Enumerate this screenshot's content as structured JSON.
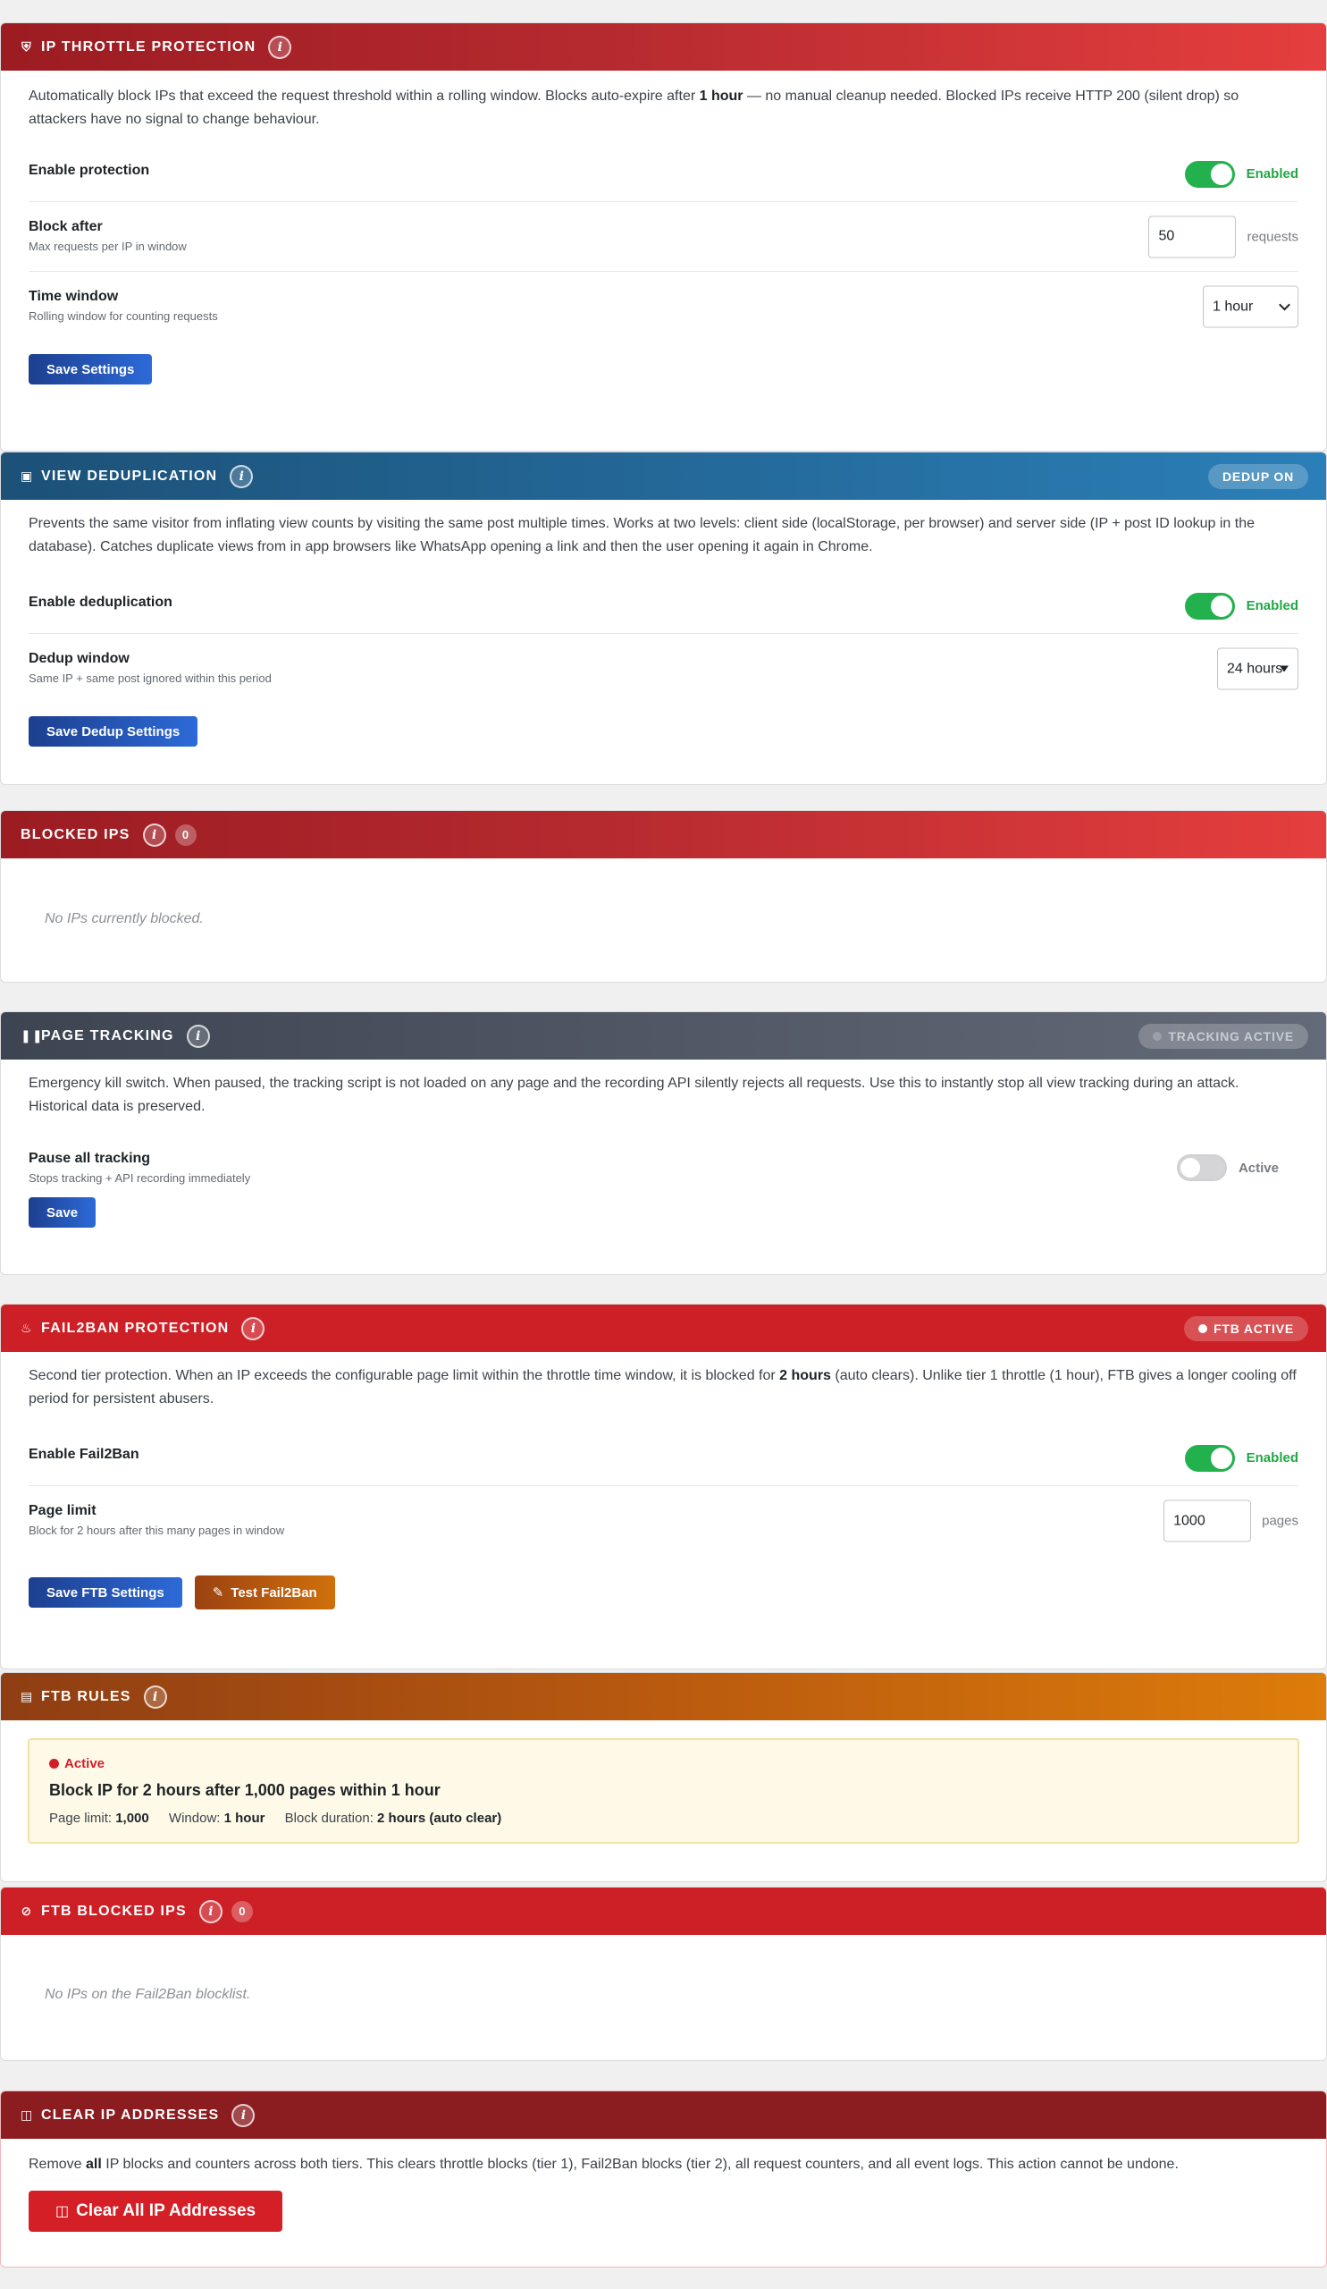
{
  "throttle": {
    "title": "IP THROTTLE PROTECTION",
    "desc_pre": "Automatically block IPs that exceed the request threshold within a rolling window. Blocks auto-expire after ",
    "desc_bold": "1 hour",
    "desc_post": " — no manual cleanup needed. Blocked IPs receive HTTP 200 (silent drop) so attackers have no signal to change behaviour.",
    "enable_label": "Enable protection",
    "enable_state": "Enabled",
    "block_label": "Block after",
    "block_sub": "Max requests per IP in window",
    "block_value": "50",
    "block_unit": "requests",
    "window_label": "Time window",
    "window_sub": "Rolling window for counting requests",
    "window_value": "1 hour",
    "save": "Save Settings"
  },
  "dedup": {
    "title": "VIEW DEDUPLICATION",
    "badge": "DEDUP ON",
    "desc": "Prevents the same visitor from inflating view counts by visiting the same post multiple times. Works at two levels: client side (localStorage, per browser) and server side (IP + post ID lookup in the database). Catches duplicate views from in app browsers like WhatsApp opening a link and then the user opening it again in Chrome.",
    "enable_label": "Enable deduplication",
    "enable_state": "Enabled",
    "window_label": "Dedup window",
    "window_sub": "Same IP + same post ignored within this period",
    "window_value": "24 hours",
    "save": "Save Dedup Settings"
  },
  "blocked": {
    "title": "BLOCKED IPS",
    "count": "0",
    "empty": "No IPs currently blocked."
  },
  "tracking": {
    "title": "PAGE TRACKING",
    "badge": "TRACKING ACTIVE",
    "desc": "Emergency kill switch. When paused, the tracking script is not loaded on any page and the recording API silently rejects all requests. Use this to instantly stop all view tracking during an attack. Historical data is preserved.",
    "pause_label": "Pause all tracking",
    "pause_sub": "Stops tracking + API recording immediately",
    "pause_state": "Active",
    "save": "Save"
  },
  "fail2ban": {
    "title": "FAIL2BAN PROTECTION",
    "badge": "FTB ACTIVE",
    "desc_pre": "Second tier protection. When an IP exceeds the configurable page limit within the throttle time window, it is blocked for ",
    "desc_bold": "2 hours",
    "desc_post": " (auto clears). Unlike tier 1 throttle (1 hour), FTB gives a longer cooling off period for persistent abusers.",
    "enable_label": "Enable Fail2Ban",
    "enable_state": "Enabled",
    "limit_label": "Page limit",
    "limit_sub": "Block for 2 hours after this many pages in window",
    "limit_value": "1000",
    "limit_unit": "pages",
    "save": "Save FTB Settings",
    "test": "Test Fail2Ban"
  },
  "rules": {
    "title": "FTB RULES",
    "status": "Active",
    "rule_title": "Block IP for 2 hours after 1,000 pages within 1 hour",
    "limit_k": "Page limit:",
    "limit_v": "1,000",
    "window_k": "Window:",
    "window_v": "1 hour",
    "duration_k": "Block duration:",
    "duration_v": "2 hours (auto clear)"
  },
  "ftb_blocked": {
    "title": "FTB BLOCKED IPS",
    "count": "0",
    "empty": "No IPs on the Fail2Ban blocklist."
  },
  "clear": {
    "title": "CLEAR IP ADDRESSES",
    "desc_pre": "Remove ",
    "desc_bold": "all",
    "desc_post": " IP blocks and counters across both tiers. This clears throttle blocks (tier 1), Fail2Ban blocks (tier 2), all request counters, and all event logs. This action cannot be undone.",
    "button": "Clear All IP Addresses"
  },
  "colors": {
    "red_gradient_start": "#9b1c22",
    "red_gradient_end": "#e53e3e",
    "blue_header": "#2b7fb8",
    "slate_header": "#4b5260",
    "crimson_header": "#cd2026",
    "orange_header": "#dd7c0a",
    "toggle_on": "#22b14c",
    "primary_button": "#2d6ad8"
  }
}
